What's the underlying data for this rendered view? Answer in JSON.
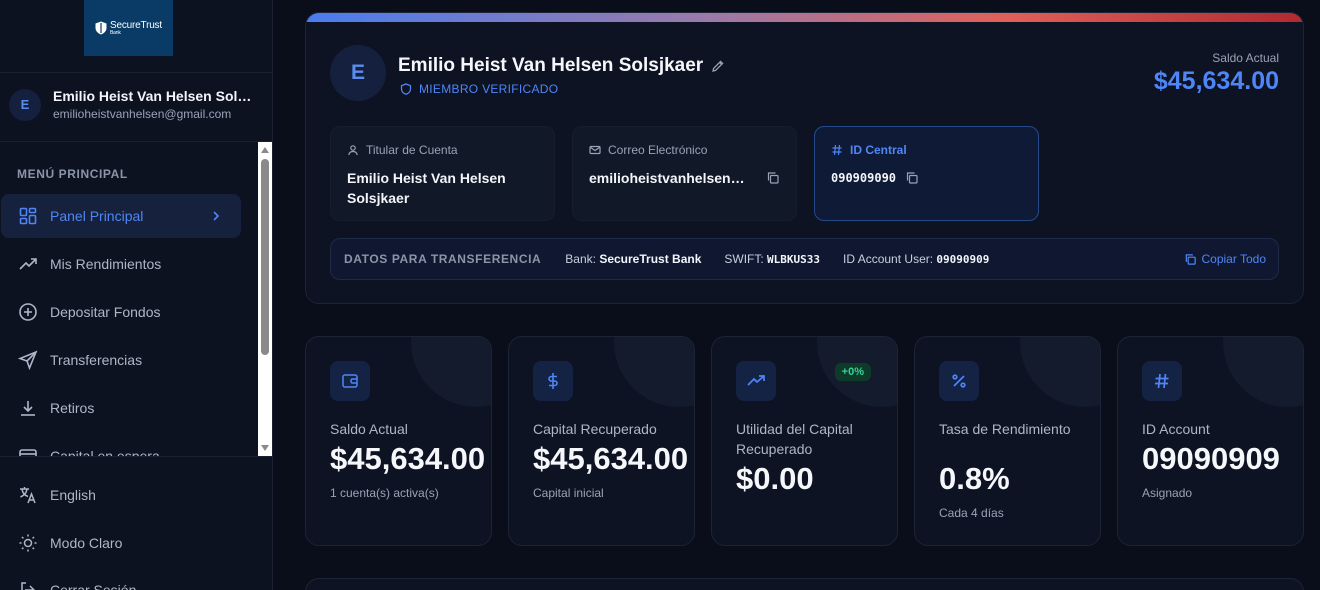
{
  "brand": {
    "name": "SecureTrust",
    "sub": "Bank"
  },
  "user": {
    "initial": "E",
    "name": "Emilio Heist Van Helsen Solsjkaer",
    "email": "emilioheistvanhelsen@gmail.com"
  },
  "menu": {
    "title": "MENÚ PRINCIPAL",
    "items": [
      {
        "label": "Panel Principal",
        "icon": "dashboard-icon",
        "active": true
      },
      {
        "label": "Mis Rendimientos",
        "icon": "trending-up-icon"
      },
      {
        "label": "Depositar Fondos",
        "icon": "plus-circle-icon"
      },
      {
        "label": "Transferencias",
        "icon": "send-icon"
      },
      {
        "label": "Retiros",
        "icon": "download-icon"
      },
      {
        "label": "Capital en espera",
        "icon": "card-icon"
      }
    ]
  },
  "bottom_menu": {
    "language": "English",
    "theme": "Modo Claro",
    "logout": "Cerrar Sesión"
  },
  "profile": {
    "initial": "E",
    "name": "Emilio Heist Van Helsen Solsjkaer",
    "verified": "MIEMBRO VERIFICADO",
    "balance_label": "Saldo Actual",
    "balance_value": "$45,634.00",
    "boxes": [
      {
        "label": "Titular de Cuenta",
        "value": "Emilio Heist Van Helsen Solsjkaer",
        "icon": "user-icon"
      },
      {
        "label": "Correo Electrónico",
        "value": "emilioheistvanhelsen@gmail.com",
        "icon": "mail-icon"
      },
      {
        "label": "ID Central",
        "value": "090909090",
        "icon": "hash-icon"
      }
    ],
    "transfer": {
      "title": "DATOS PARA TRANSFERENCIA",
      "bank_label": "Bank:",
      "bank_value": "SecureTrust Bank",
      "swift_label": "SWIFT:",
      "swift_value": "WLBKUS33",
      "account_label": "ID Account User:",
      "account_value": "09090909",
      "copy_all": "Copiar Todo"
    }
  },
  "stats": [
    {
      "label": "Saldo Actual",
      "value": "$45,634.00",
      "sub": "1 cuenta(s) activa(s)",
      "icon": "wallet-icon"
    },
    {
      "label": "Capital Recuperado",
      "value": "$45,634.00",
      "sub": "Capital inicial",
      "icon": "dollar-icon"
    },
    {
      "label": "Utilidad del Capital Recuperado",
      "value": "$0.00",
      "sub": "",
      "badge": "+0%",
      "icon": "trending-up-icon"
    },
    {
      "label": "Tasa de Rendimiento",
      "value": "0.8%",
      "sub": "Cada 4 días",
      "icon": "percent-icon"
    },
    {
      "label": "ID Account",
      "value": "09090909",
      "sub": "Asignado",
      "icon": "hash-icon"
    }
  ],
  "colors": {
    "accent": "#4f86f7",
    "background": "#0a0e1a",
    "card": "#0d1322",
    "success": "#34d399"
  }
}
